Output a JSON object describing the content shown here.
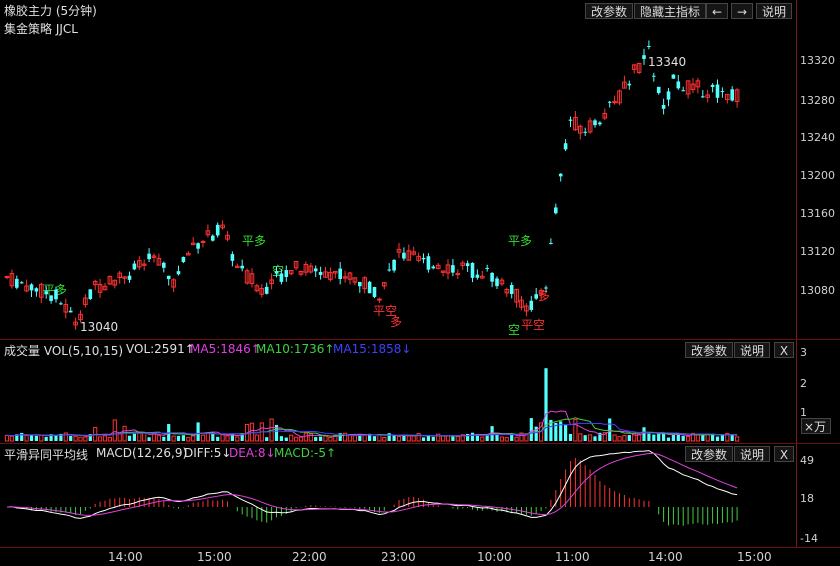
{
  "header": {
    "title": "橡胶主力 (5分钟)",
    "strategy": "集金策略 JJCL",
    "buttons": {
      "params": "改参数",
      "hide_indicator": "隐藏主指标",
      "prev": "←",
      "next": "→",
      "help": "说明"
    }
  },
  "main_chart": {
    "y_ticks": [
      "13320",
      "13280",
      "13240",
      "13200",
      "13160",
      "13120",
      "13080"
    ],
    "high_label": "13340",
    "low_label": "13040",
    "signals": [
      {
        "text": "平多",
        "color": "#33dd33"
      },
      {
        "text": "平多",
        "color": "#33dd33"
      },
      {
        "text": "空",
        "color": "#33dd33"
      },
      {
        "text": "平空",
        "color": "#ff3333"
      },
      {
        "text": "多",
        "color": "#ff3333"
      },
      {
        "text": "平多",
        "color": "#33dd33"
      },
      {
        "text": "空",
        "color": "#33dd33"
      },
      {
        "text": "平空",
        "color": "#ff3333"
      },
      {
        "text": "多",
        "color": "#ff3333"
      }
    ]
  },
  "volume_panel": {
    "title": "成交量 VOL(5,10,15)",
    "vol": "VOL:2591↑",
    "ma5": "MA5:1846↑",
    "ma10": "MA10:1736↑",
    "ma15": "MA15:1858↓",
    "buttons": {
      "params": "改参数",
      "help": "说明",
      "close": "X"
    },
    "y_ticks": [
      "3",
      "2",
      "1"
    ],
    "unit": "×万"
  },
  "macd_panel": {
    "title": "平滑异同平均线",
    "params": "MACD(12,26,9)",
    "diff": "DIFF:5↓",
    "dea": "DEA:8↓",
    "macd": "MACD:-5↑",
    "buttons": {
      "params": "改参数",
      "help": "说明",
      "close": "X"
    },
    "y_ticks": [
      "49",
      "18",
      "-14"
    ]
  },
  "time_axis": [
    "14:00",
    "15:00",
    "22:00",
    "23:00",
    "10:00",
    "11:00",
    "14:00",
    "15:00"
  ],
  "colors": {
    "up": "#ff3232",
    "down": "#54ffff",
    "ma5": "#e040e0",
    "ma10": "#40d040",
    "ma15": "#4040ff",
    "diff": "#ffffff",
    "dea": "#e040e0"
  }
}
